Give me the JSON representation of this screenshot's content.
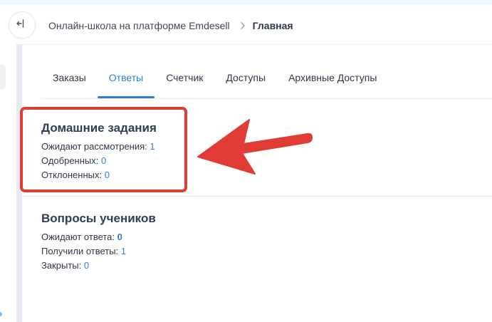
{
  "header": {
    "school_name": "Онлайн-школа на платформе Emdesell",
    "current_page": "Главная"
  },
  "tabs": [
    {
      "label": "Заказы",
      "active": false
    },
    {
      "label": "Ответы",
      "active": true
    },
    {
      "label": "Счетчик",
      "active": false
    },
    {
      "label": "Доступы",
      "active": false
    },
    {
      "label": "Архивные Доступы",
      "active": false
    }
  ],
  "homework": {
    "title": "Домашние задания",
    "pending_label": "Ожидают рассмотрения:",
    "pending_value": "1",
    "approved_label": "Одобренных:",
    "approved_value": "0",
    "rejected_label": "Отклоненных:",
    "rejected_value": "0"
  },
  "questions": {
    "title": "Вопросы учеников",
    "awaiting_label": "Ожидают ответа:",
    "awaiting_value": "0",
    "answered_label": "Получили ответы:",
    "answered_value": "1",
    "closed_label": "Закрыты:",
    "closed_value": "0"
  },
  "colors": {
    "accent": "#2f7fd0",
    "annotation": "#e03b34"
  },
  "icons": {
    "collapse": "collapse-sidebar-icon",
    "separator": "chevron-right-icon"
  }
}
